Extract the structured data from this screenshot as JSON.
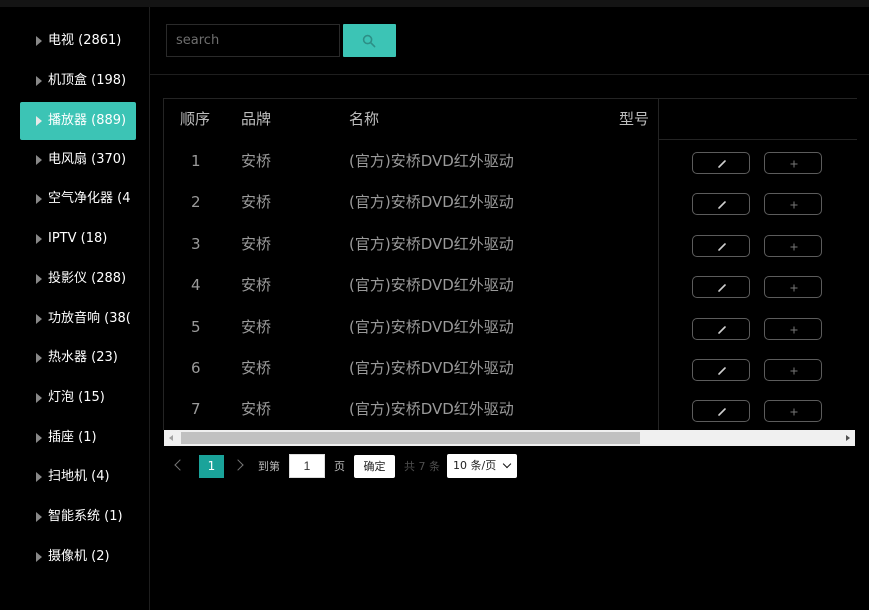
{
  "sidebar": {
    "items": [
      {
        "label": "电视 (2861)"
      },
      {
        "label": "机顶盒 (198)"
      },
      {
        "label": "播放器 (889)"
      },
      {
        "label": "电风扇 (370)"
      },
      {
        "label": "空气净化器 (4"
      },
      {
        "label": "IPTV (18)"
      },
      {
        "label": "投影仪 (288)"
      },
      {
        "label": "功放音响 (38("
      },
      {
        "label": "热水器 (23)"
      },
      {
        "label": "灯泡 (15)"
      },
      {
        "label": "插座 (1)"
      },
      {
        "label": "扫地机 (4)"
      },
      {
        "label": "智能系统 (1)"
      },
      {
        "label": "摄像机 (2)"
      }
    ],
    "active_index": 2,
    "accent_color": "#3cc4b5"
  },
  "search": {
    "placeholder": "search",
    "button_icon": "search-icon"
  },
  "table": {
    "columns": [
      "顺序",
      "品牌",
      "名称",
      "型号"
    ],
    "rows": [
      {
        "index": "1",
        "brand": "安桥",
        "name": "(官方)安桥DVD红外驱动",
        "model": ""
      },
      {
        "index": "2",
        "brand": "安桥",
        "name": "(官方)安桥DVD红外驱动",
        "model": ""
      },
      {
        "index": "3",
        "brand": "安桥",
        "name": "(官方)安桥DVD红外驱动",
        "model": ""
      },
      {
        "index": "4",
        "brand": "安桥",
        "name": "(官方)安桥DVD红外驱动",
        "model": ""
      },
      {
        "index": "5",
        "brand": "安桥",
        "name": "(官方)安桥DVD红外驱动",
        "model": ""
      },
      {
        "index": "6",
        "brand": "安桥",
        "name": "(官方)安桥DVD红外驱动",
        "model": ""
      },
      {
        "index": "7",
        "brand": "安桥",
        "name": "(官方)安桥DVD红外驱动",
        "model": ""
      }
    ],
    "row_actions": [
      "edit-icon",
      "add-icon"
    ]
  },
  "pagination": {
    "current_page": "1",
    "goto_label": "到第",
    "goto_value": "1",
    "page_label": "页",
    "confirm_label": "确定",
    "total_label": "共 7 条",
    "page_size_label": "10 条/页",
    "primary_color": "#1aa39a"
  }
}
